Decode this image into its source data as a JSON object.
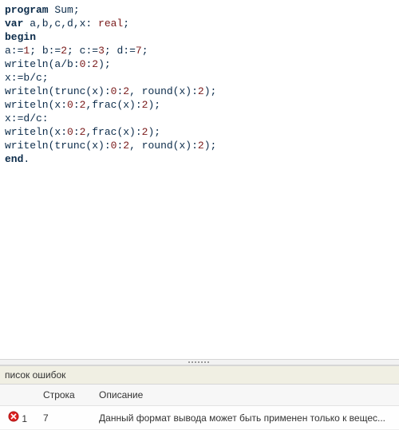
{
  "code_lines": [
    [
      {
        "cls": "kw",
        "text": "program"
      },
      {
        "cls": "plain",
        "text": " Sum;"
      }
    ],
    [
      {
        "cls": "kw",
        "text": "var"
      },
      {
        "cls": "plain",
        "text": " a,b,c,d,x: "
      },
      {
        "cls": "type",
        "text": "real"
      },
      {
        "cls": "plain",
        "text": ";"
      }
    ],
    [
      {
        "cls": "kw",
        "text": "begin"
      }
    ],
    [
      {
        "cls": "plain",
        "text": "a:="
      },
      {
        "cls": "num",
        "text": "1"
      },
      {
        "cls": "plain",
        "text": "; b:="
      },
      {
        "cls": "num",
        "text": "2"
      },
      {
        "cls": "plain",
        "text": "; c:="
      },
      {
        "cls": "num",
        "text": "3"
      },
      {
        "cls": "plain",
        "text": "; d:="
      },
      {
        "cls": "num",
        "text": "7"
      },
      {
        "cls": "plain",
        "text": ";"
      }
    ],
    [
      {
        "cls": "plain",
        "text": "writeln(a/b:"
      },
      {
        "cls": "num",
        "text": "0"
      },
      {
        "cls": "plain",
        "text": ":"
      },
      {
        "cls": "num",
        "text": "2"
      },
      {
        "cls": "plain",
        "text": ");"
      }
    ],
    [
      {
        "cls": "plain",
        "text": "x:=b/c;"
      }
    ],
    [
      {
        "cls": "plain",
        "text": "writeln(trunc(x):"
      },
      {
        "cls": "num",
        "text": "0"
      },
      {
        "cls": "plain",
        "text": ":"
      },
      {
        "cls": "num",
        "text": "2"
      },
      {
        "cls": "plain",
        "text": ", round(x):"
      },
      {
        "cls": "num",
        "text": "2"
      },
      {
        "cls": "plain",
        "text": ");"
      }
    ],
    [
      {
        "cls": "plain",
        "text": "writeln(x:"
      },
      {
        "cls": "num",
        "text": "0"
      },
      {
        "cls": "plain",
        "text": ":"
      },
      {
        "cls": "num",
        "text": "2"
      },
      {
        "cls": "plain",
        "text": ",frac(x):"
      },
      {
        "cls": "num",
        "text": "2"
      },
      {
        "cls": "plain",
        "text": ");"
      }
    ],
    [
      {
        "cls": "plain",
        "text": "x:=d/c:"
      }
    ],
    [
      {
        "cls": "plain",
        "text": "writeln(x:"
      },
      {
        "cls": "num",
        "text": "0"
      },
      {
        "cls": "plain",
        "text": ":"
      },
      {
        "cls": "num",
        "text": "2"
      },
      {
        "cls": "plain",
        "text": ",frac(x):"
      },
      {
        "cls": "num",
        "text": "2"
      },
      {
        "cls": "plain",
        "text": ");"
      }
    ],
    [
      {
        "cls": "plain",
        "text": "writeln(trunc(x):"
      },
      {
        "cls": "num",
        "text": "0"
      },
      {
        "cls": "plain",
        "text": ":"
      },
      {
        "cls": "num",
        "text": "2"
      },
      {
        "cls": "plain",
        "text": ", round(x):"
      },
      {
        "cls": "num",
        "text": "2"
      },
      {
        "cls": "plain",
        "text": ");"
      }
    ],
    [
      {
        "cls": "kw",
        "text": "end"
      },
      {
        "cls": "plain",
        "text": "."
      }
    ]
  ],
  "panel": {
    "title": "писок ошибок",
    "headers": {
      "line": "Строка",
      "desc": "Описание"
    },
    "errors": [
      {
        "line": "7",
        "row": "1",
        "desc": "Данный формат вывода может быть применен только к вещес..."
      }
    ]
  }
}
